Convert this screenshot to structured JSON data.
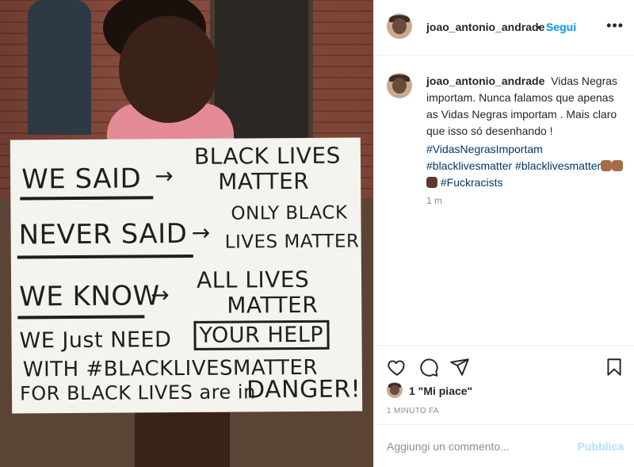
{
  "post": {
    "username": "joao_antonio_andrade",
    "separator": "•",
    "follow_label": "Segui",
    "more_label": "•••",
    "caption": "Vidas Negras importam. Nunca falamos que apenas as Vidas Negras importam . Mais claro que isso só desenhando !",
    "hashtags": [
      "#VidasNegrasImportam",
      "#blacklivesmatter",
      "#blacklivesmatter",
      "#Fuckracists"
    ],
    "comment_time": "1 m",
    "likes_text": "1 \"Mi piace\"",
    "timestamp": "1 MINUTO FA",
    "comment_placeholder": "Aggiungi un commento...",
    "publish_label": "Pubblica"
  },
  "sign": {
    "line1_left": "WE SAID",
    "line1_right": "BLACK LIVES",
    "line1_right2": "MATTER",
    "line2_left": "NEVER SAID",
    "line2_right": "ONLY BLACK",
    "line2_right2": "LIVES MATTER",
    "line3_left": "WE KNOW",
    "line3_right": "ALL LIVES",
    "line3_right2": "MATTER",
    "line4_left": "WE Just NEED",
    "line4_boxed": "YOUR HELP",
    "line5": "WITH #BLACKLIVESMATTER",
    "line6_left": "FOR BLACK LIVES are in",
    "line6_right": "DANGER!"
  },
  "icons": {
    "like": "heart-icon",
    "comment": "comment-icon",
    "share": "paper-plane-icon",
    "save": "bookmark-icon"
  },
  "colors": {
    "link": "#0095f6",
    "hashtag": "#00376b",
    "muted": "#8e8e8e",
    "publish_disabled": "#b2dffc"
  }
}
